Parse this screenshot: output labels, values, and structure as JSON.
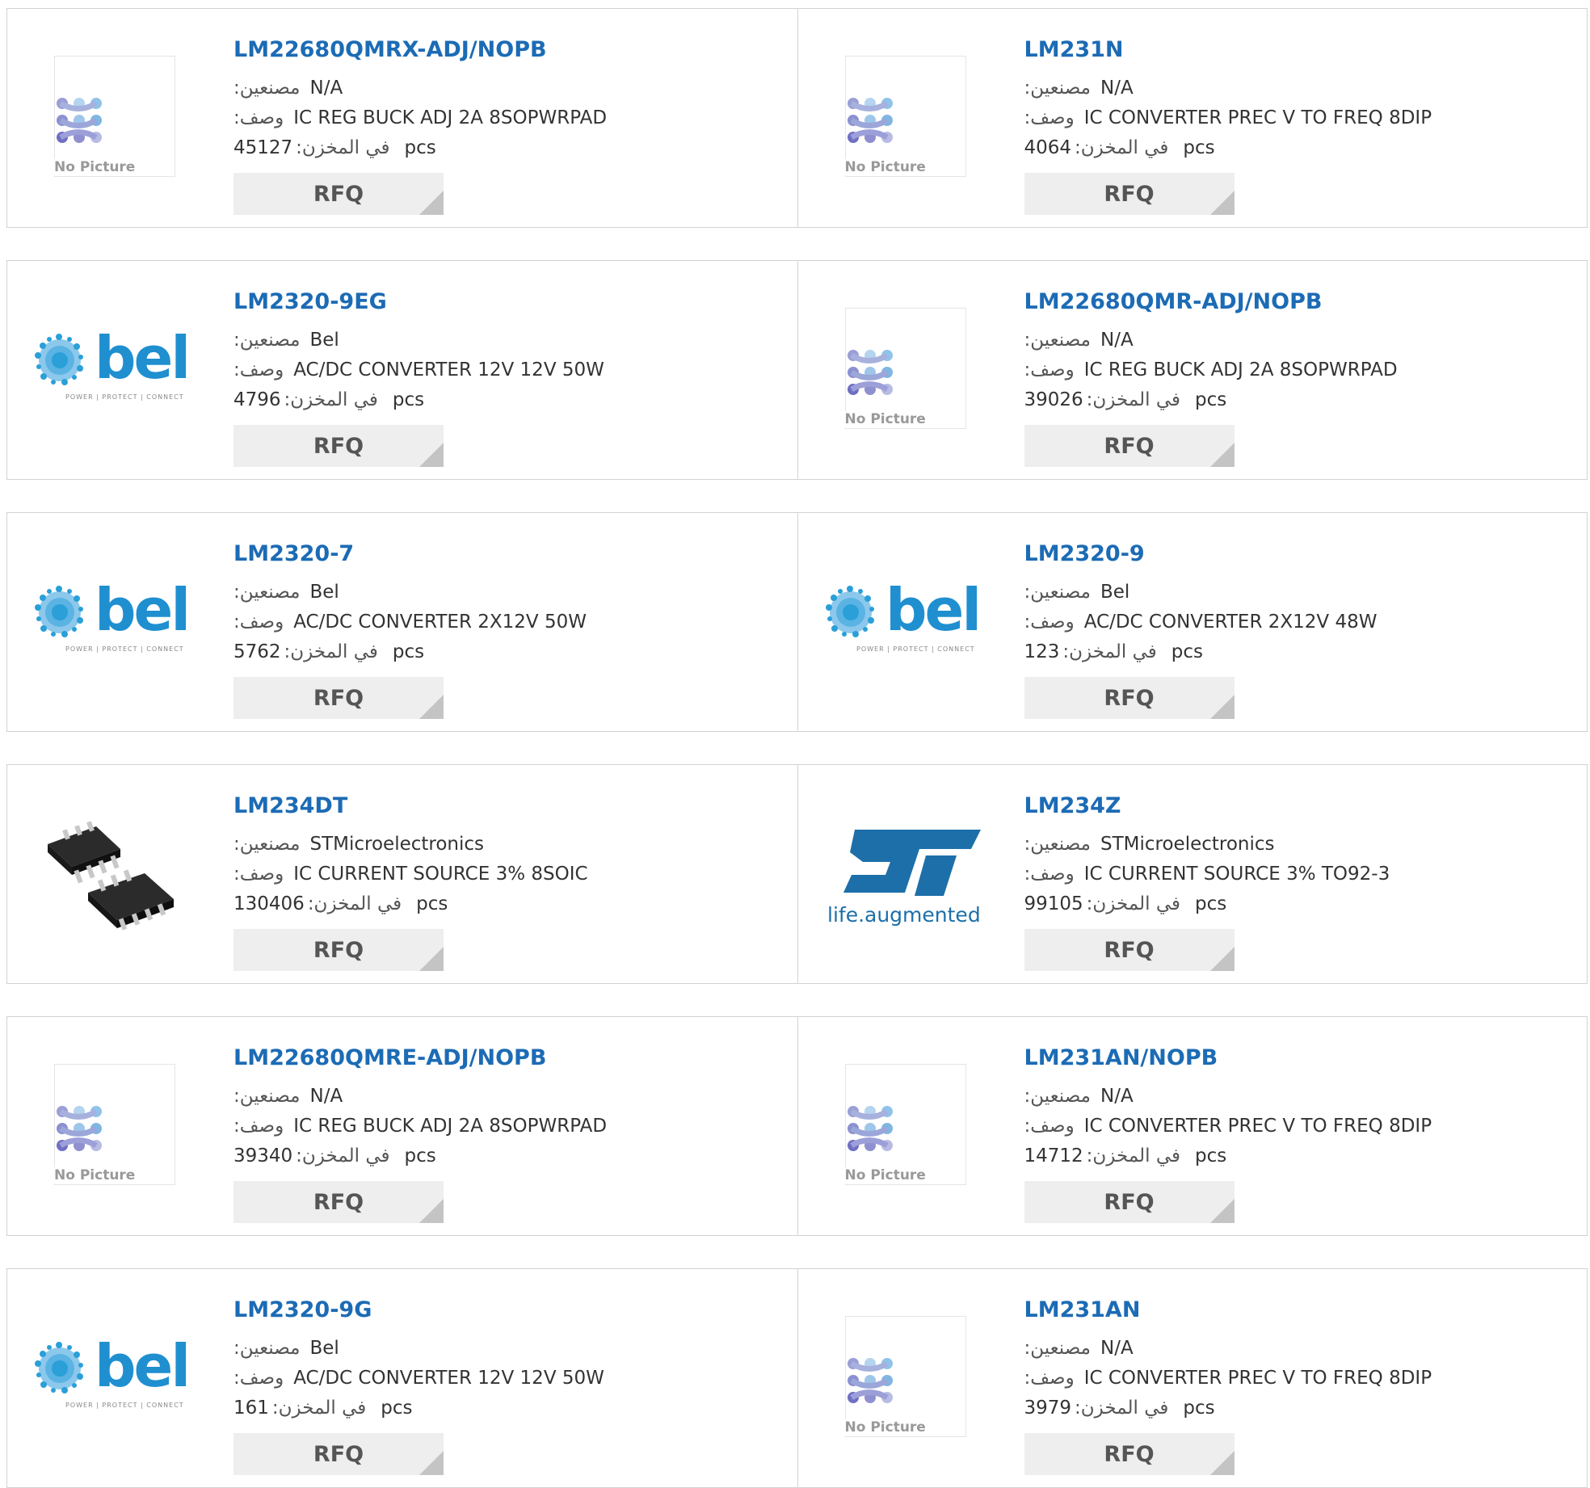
{
  "labels": {
    "manufacturer": "مصنعين:",
    "description": "وصف:",
    "stock": "في المخزن:",
    "unit": "pcs",
    "rfq": "RFQ",
    "no_picture": "No Picture"
  },
  "colors": {
    "part_link": "#1c6bb5",
    "rfq_bg": "#eeeeee",
    "border": "#d2d2d2"
  },
  "products": [
    {
      "part": "LM22680QMRX-ADJ/NOPB",
      "manufacturer": "N/A",
      "description": "IC REG BUCK ADJ 2A 8SOPWRPAD",
      "stock": "45127",
      "image": "no-picture"
    },
    {
      "part": "LM231N",
      "manufacturer": "N/A",
      "description": "IC CONVERTER PREC V TO FREQ 8DIP",
      "stock": "4064",
      "image": "no-picture"
    },
    {
      "part": "LM2320-9EG",
      "manufacturer": "Bel",
      "description": "AC/DC CONVERTER 12V 12V 50W",
      "stock": "4796",
      "image": "bel-logo"
    },
    {
      "part": "LM22680QMR-ADJ/NOPB",
      "manufacturer": "N/A",
      "description": "IC REG BUCK ADJ 2A 8SOPWRPAD",
      "stock": "39026",
      "image": "no-picture"
    },
    {
      "part": "LM2320-7",
      "manufacturer": "Bel",
      "description": "AC/DC CONVERTER 2X12V 50W",
      "stock": "5762",
      "image": "bel-logo"
    },
    {
      "part": "LM2320-9",
      "manufacturer": "Bel",
      "description": "AC/DC CONVERTER 2X12V 48W",
      "stock": "123",
      "image": "bel-logo"
    },
    {
      "part": "LM234DT",
      "manufacturer": "STMicroelectronics",
      "description": "IC CURRENT SOURCE 3% 8SOIC",
      "stock": "130406",
      "image": "soic-chip"
    },
    {
      "part": "LM234Z",
      "manufacturer": "STMicroelectronics",
      "description": "IC CURRENT SOURCE 3% TO92-3",
      "stock": "99105",
      "image": "st-logo"
    },
    {
      "part": "LM22680QMRE-ADJ/NOPB",
      "manufacturer": "N/A",
      "description": "IC REG BUCK ADJ 2A 8SOPWRPAD",
      "stock": "39340",
      "image": "no-picture"
    },
    {
      "part": "LM231AN/NOPB",
      "manufacturer": "N/A",
      "description": "IC CONVERTER PREC V TO FREQ 8DIP",
      "stock": "14712",
      "image": "no-picture"
    },
    {
      "part": "LM2320-9G",
      "manufacturer": "Bel",
      "description": "AC/DC CONVERTER 12V 12V 50W",
      "stock": "161",
      "image": "bel-logo"
    },
    {
      "part": "LM231AN",
      "manufacturer": "N/A",
      "description": "IC CONVERTER PREC V TO FREQ 8DIP",
      "stock": "3979",
      "image": "no-picture"
    }
  ]
}
